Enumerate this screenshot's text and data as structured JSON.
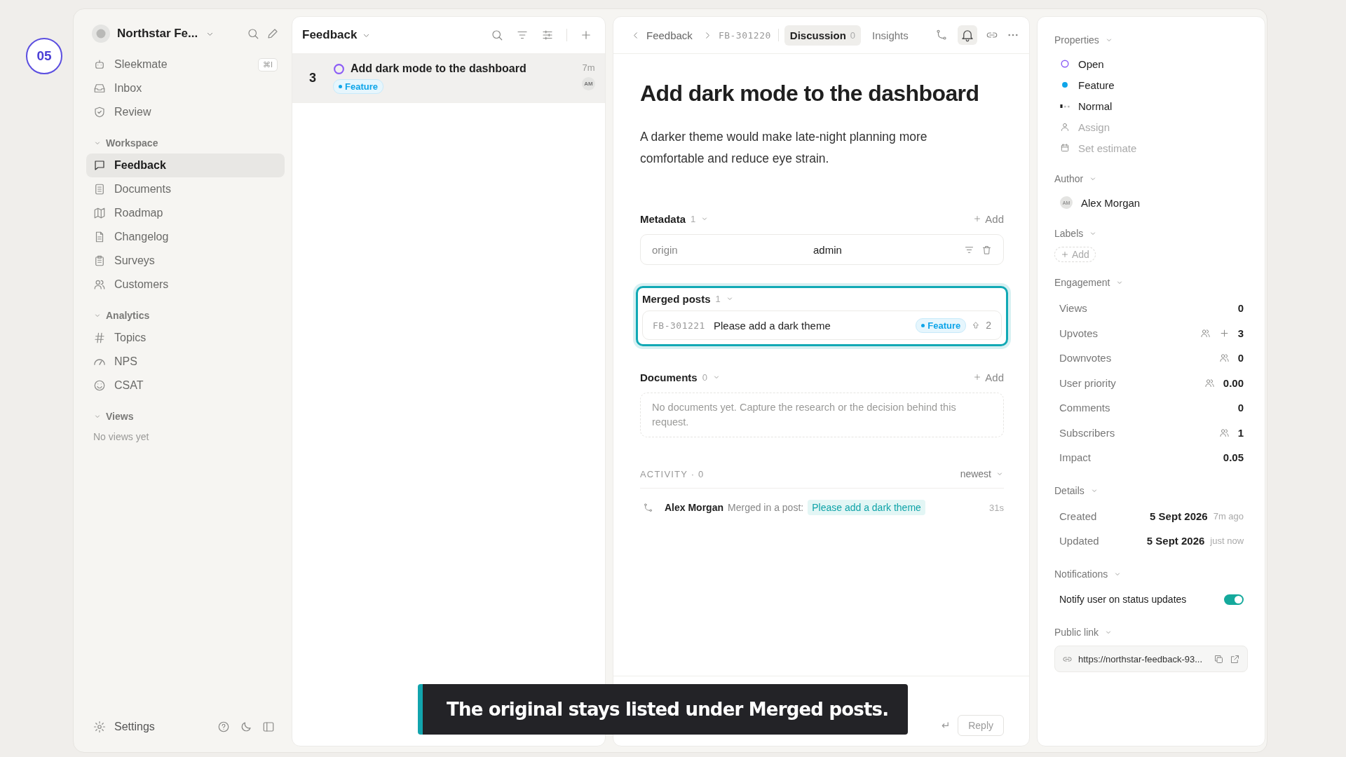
{
  "step_badge": "05",
  "sidebar": {
    "workspace": "Northstar Fe...",
    "top_items": [
      {
        "label": "Sleekmate",
        "shortcut": "⌘I",
        "selected": false
      },
      {
        "label": "Inbox",
        "selected": false
      },
      {
        "label": "Review",
        "selected": false
      }
    ],
    "sections": [
      {
        "title": "Workspace",
        "expanded": true,
        "items": [
          {
            "label": "Feedback",
            "selected": true
          },
          {
            "label": "Documents",
            "selected": false
          },
          {
            "label": "Roadmap",
            "selected": false
          },
          {
            "label": "Changelog",
            "selected": false
          },
          {
            "label": "Surveys",
            "selected": false
          },
          {
            "label": "Customers",
            "selected": false
          }
        ]
      },
      {
        "title": "Analytics",
        "expanded": true,
        "items": [
          {
            "label": "Topics",
            "selected": false
          },
          {
            "label": "NPS",
            "selected": false
          },
          {
            "label": "CSAT",
            "selected": false
          }
        ]
      },
      {
        "title": "Views",
        "expanded": true,
        "empty_text": "No views yet"
      }
    ],
    "settings": "Settings"
  },
  "list": {
    "title": "Feedback",
    "items": [
      {
        "votes": "3",
        "title": "Add dark mode to the dashboard",
        "tag": "Feature",
        "age": "7m",
        "avatar": "AM",
        "selected": true
      }
    ]
  },
  "detail": {
    "breadcrumb": [
      "Feedback",
      "FB-301220"
    ],
    "tabs": [
      {
        "label": "Discussion",
        "count": "0",
        "selected": true
      },
      {
        "label": "Insights",
        "selected": false
      }
    ],
    "title": "Add dark mode to the dashboard",
    "description": "A darker theme would make late-night planning more comfortable and reduce eye strain.",
    "metadata": {
      "title": "Metadata",
      "count": "1",
      "add": "Add",
      "rows": [
        {
          "key": "origin",
          "value": "admin"
        }
      ]
    },
    "merged": {
      "title": "Merged posts",
      "count": "1",
      "highlighted": true,
      "posts": [
        {
          "id": "FB-301221",
          "title": "Please add a dark theme",
          "tag": "Feature",
          "votes": "2"
        }
      ]
    },
    "documents": {
      "title": "Documents",
      "count": "0",
      "add": "Add",
      "empty_text": "No documents yet. Capture the research or the decision behind this request."
    },
    "activity": {
      "heading": "ACTIVITY · 0",
      "sort": "newest",
      "entries": [
        {
          "author": "Alex Morgan",
          "action": "Merged in a post:",
          "link": "Please add a dark theme",
          "time": "31s"
        }
      ]
    },
    "composer": {
      "enter_glyph": "↵",
      "reply": "Reply"
    }
  },
  "properties": {
    "title": "Properties",
    "items": [
      {
        "kind": "status",
        "label": "Open",
        "color": "#8b5cf6",
        "empty": false
      },
      {
        "kind": "type",
        "label": "Feature",
        "color": "#0ea5e9",
        "empty": false
      },
      {
        "kind": "priority",
        "label": "Normal",
        "empty": false
      },
      {
        "kind": "assignee",
        "label": "Assign",
        "empty": true
      },
      {
        "kind": "estimate",
        "label": "Set estimate",
        "empty": true
      }
    ],
    "author": {
      "title": "Author",
      "avatar": "AM",
      "name": "Alex Morgan"
    },
    "labels": {
      "title": "Labels",
      "add": "Add"
    },
    "engagement": {
      "title": "Engagement",
      "rows": [
        {
          "label": "Views",
          "value": "0",
          "voters": false,
          "addable": false
        },
        {
          "label": "Upvotes",
          "value": "3",
          "voters": true,
          "addable": true
        },
        {
          "label": "Downvotes",
          "value": "0",
          "voters": true,
          "addable": false
        },
        {
          "label": "User priority",
          "value": "0.00",
          "voters": true,
          "addable": false
        },
        {
          "label": "Comments",
          "value": "0",
          "voters": false,
          "addable": false
        },
        {
          "label": "Subscribers",
          "value": "1",
          "voters": true,
          "addable": false
        },
        {
          "label": "Impact",
          "value": "0.05",
          "voters": false,
          "addable": false
        }
      ]
    },
    "details": {
      "title": "Details",
      "rows": [
        {
          "label": "Created",
          "date": "5 Sept 2026",
          "relative": "7m ago"
        },
        {
          "label": "Updated",
          "date": "5 Sept 2026",
          "relative": "just now"
        }
      ]
    },
    "notifications": {
      "title": "Notifications",
      "label": "Notify user on status updates",
      "on": true
    },
    "public_link": {
      "title": "Public link",
      "url": "https://northstar-feedback-93..."
    }
  },
  "caption": "The original stays listed under Merged posts."
}
